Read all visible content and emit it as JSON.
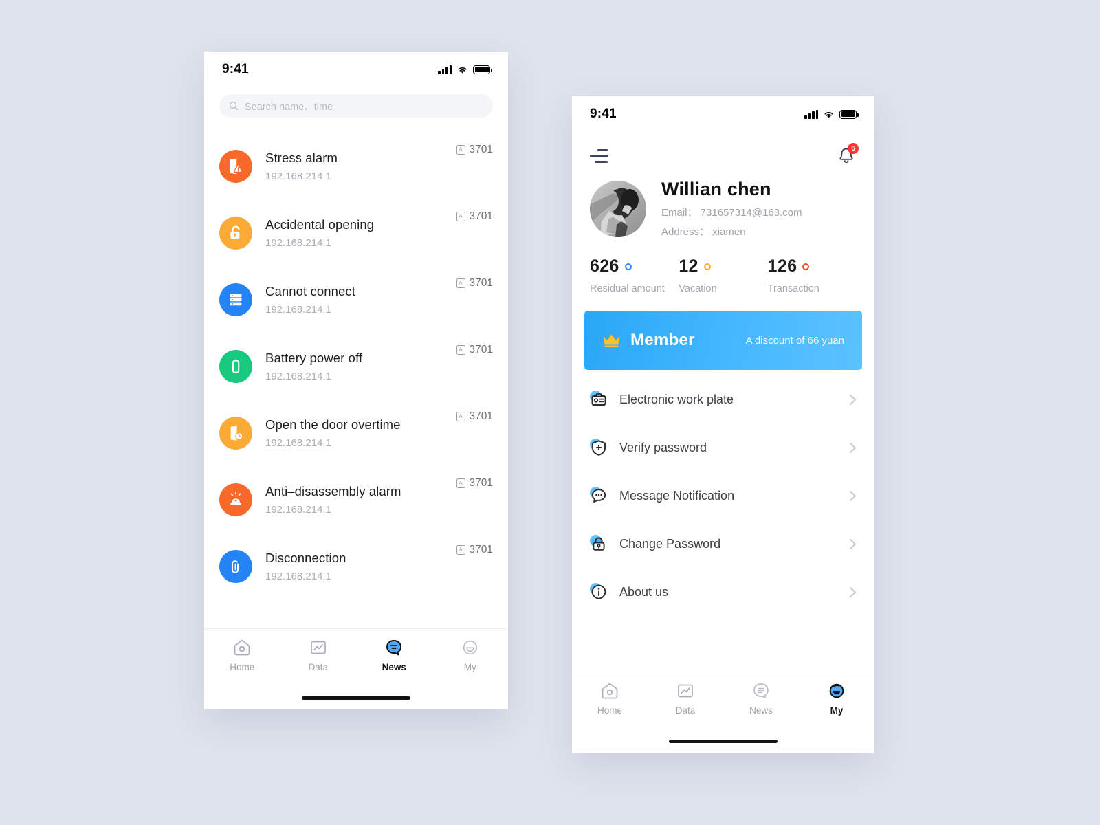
{
  "background_color": "#dfe3ed",
  "accent_blue": "#2196f3",
  "left_phone": {
    "status": {
      "time": "9:41",
      "signal_icon": "cellular-signal-icon",
      "wifi_icon": "wifi-icon",
      "battery_icon": "battery-full-icon"
    },
    "search": {
      "placeholder": "Search name、time",
      "icon": "search-icon"
    },
    "news_items": [
      {
        "title": "Stress alarm",
        "ip": "192.168.214.1",
        "device": "3701",
        "icon": "door-alert-icon",
        "color": "#f8692a"
      },
      {
        "title": "Accidental opening",
        "ip": "192.168.214.1",
        "device": "3701",
        "icon": "unlock-icon",
        "color": "#fbab35"
      },
      {
        "title": "Cannot connect",
        "ip": "192.168.214.1",
        "device": "3701",
        "icon": "server-icon",
        "color": "#2484f5"
      },
      {
        "title": "Battery power off",
        "ip": "192.168.214.1",
        "device": "3701",
        "icon": "battery-icon",
        "color": "#18ca7e"
      },
      {
        "title": "Open the door overtime",
        "ip": "192.168.214.1",
        "device": "3701",
        "icon": "door-clock-icon",
        "color": "#fbab35"
      },
      {
        "title": "Anti–disassembly alarm",
        "ip": "192.168.214.1",
        "device": "3701",
        "icon": "siren-alarm-icon",
        "color": "#f8692a"
      },
      {
        "title": "Disconnection",
        "ip": "192.168.214.1",
        "device": "3701",
        "icon": "broken-link-icon",
        "color": "#2484f5"
      }
    ],
    "tabs": [
      {
        "label": "Home",
        "icon": "home-icon",
        "active": false
      },
      {
        "label": "Data",
        "icon": "chart-icon",
        "active": false
      },
      {
        "label": "News",
        "icon": "news-icon",
        "active": true
      },
      {
        "label": "My",
        "icon": "smiley-icon",
        "active": false
      }
    ]
  },
  "right_phone": {
    "status": {
      "time": "9:41",
      "signal_icon": "cellular-signal-icon",
      "wifi_icon": "wifi-icon",
      "battery_icon": "battery-full-icon"
    },
    "nav": {
      "menu_icon": "hamburger-menu-icon",
      "bell_icon": "notification-bell-icon",
      "badge_count": "6"
    },
    "profile": {
      "avatar_icon": "user-avatar-photo",
      "name": "Willian chen",
      "email_line": "Email： 731657314@163.com",
      "address_line": "Address： xiamen"
    },
    "stats": [
      {
        "value": "626",
        "label": "Residual amount",
        "dot_color": "#1f8fff"
      },
      {
        "value": "12",
        "label": "Vacation",
        "dot_color": "#fbb216"
      },
      {
        "value": "126",
        "label": "Transaction",
        "dot_color": "#f5482c"
      }
    ],
    "member_banner": {
      "icon": "crown-icon",
      "title": "Member",
      "subtitle": "A discount of 66 yuan"
    },
    "menu_items": [
      {
        "label": "Electronic work plate",
        "icon": "id-badge-icon"
      },
      {
        "label": "Verify password",
        "icon": "shield-plus-icon"
      },
      {
        "label": "Message Notification",
        "icon": "chat-bubble-icon"
      },
      {
        "label": "Change Password",
        "icon": "lock-icon"
      },
      {
        "label": "About us",
        "icon": "info-circle-icon"
      }
    ],
    "chevron_icon": "chevron-right-icon",
    "tabs": [
      {
        "label": "Home",
        "icon": "home-icon",
        "active": false
      },
      {
        "label": "Data",
        "icon": "chart-icon",
        "active": false
      },
      {
        "label": "News",
        "icon": "news-icon",
        "active": false
      },
      {
        "label": "My",
        "icon": "smiley-icon",
        "active": true
      }
    ]
  }
}
